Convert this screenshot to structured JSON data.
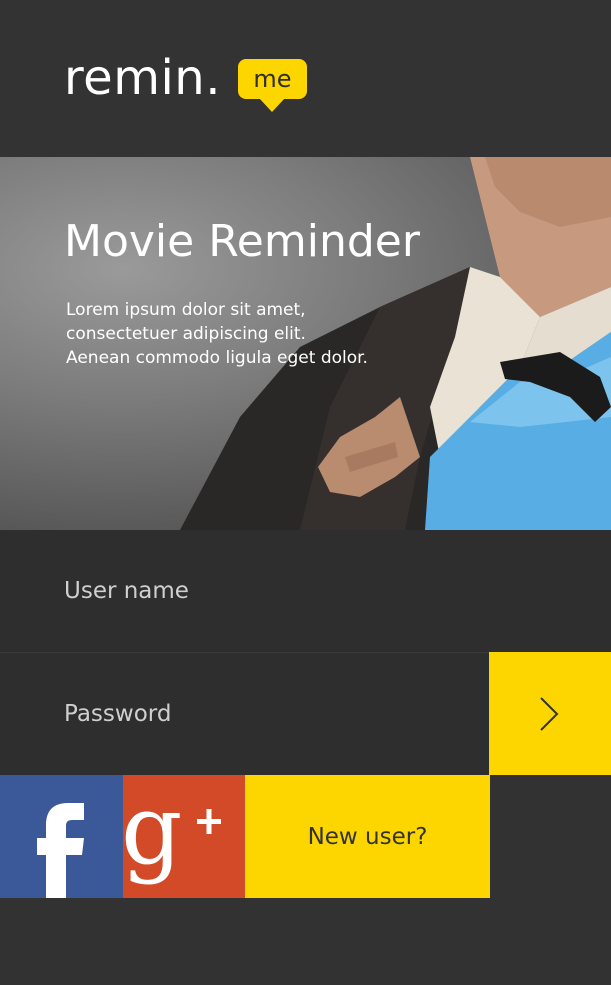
{
  "logo": {
    "text": "remin.",
    "badge": "me"
  },
  "hero": {
    "title": "Movie Reminder",
    "description_lines": [
      "Lorem ipsum dolor sit amet,",
      "consectetuer adipiscing elit.",
      "Aenean commodo ligula eget dolor."
    ]
  },
  "form": {
    "username_placeholder": "User name",
    "password_placeholder": "Password",
    "submit_icon": "chevron-right-icon"
  },
  "social": {
    "facebook_icon": "facebook-icon",
    "google_plus_icon": "google-plus-icon",
    "new_user_label": "New user?"
  },
  "colors": {
    "background": "#323232",
    "accent": "#fdd600",
    "facebook": "#3b5998",
    "google_plus": "#d34a29"
  }
}
